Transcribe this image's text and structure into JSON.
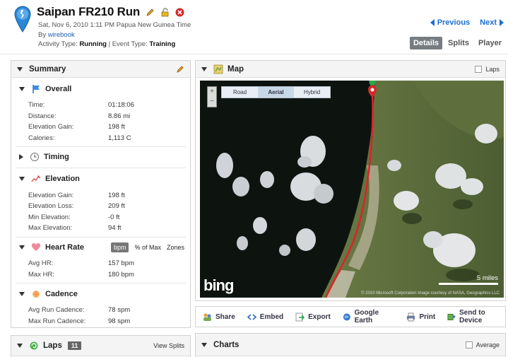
{
  "activity": {
    "title": "Saipan FR210 Run",
    "datetime": "Sat, Nov 6, 2010 1:11 PM Papua New Guinea Time",
    "by_prefix": "By ",
    "author": "wirebook",
    "activity_type_label": "Activity Type: ",
    "activity_type": "Running",
    "event_sep": " | Event Type: ",
    "event_type": "Training"
  },
  "nav": {
    "previous": "Previous",
    "next": "Next"
  },
  "tabs": [
    "Details",
    "Splits",
    "Player"
  ],
  "summary": {
    "title": "Summary",
    "overall": {
      "title": "Overall",
      "rows": [
        {
          "k": "Time:",
          "v": "01:18:06"
        },
        {
          "k": "Distance:",
          "v": "8.86 mi"
        },
        {
          "k": "Elevation Gain:",
          "v": "198 ft"
        },
        {
          "k": "Calories:",
          "v": "1,113 C"
        }
      ]
    },
    "timing": {
      "title": "Timing"
    },
    "elevation": {
      "title": "Elevation",
      "rows": [
        {
          "k": "Elevation Gain:",
          "v": "198 ft"
        },
        {
          "k": "Elevation Loss:",
          "v": "209 ft"
        },
        {
          "k": "Min Elevation:",
          "v": "-0 ft"
        },
        {
          "k": "Max Elevation:",
          "v": "94 ft"
        }
      ]
    },
    "heart_rate": {
      "title": "Heart Rate",
      "options": [
        "bpm",
        "% of Max",
        "Zones"
      ],
      "rows": [
        {
          "k": "Avg HR:",
          "v": "157 bpm"
        },
        {
          "k": "Max HR:",
          "v": "180 bpm"
        }
      ]
    },
    "cadence": {
      "title": "Cadence",
      "rows": [
        {
          "k": "Avg Run Cadence:",
          "v": "78 spm"
        },
        {
          "k": "Max Run Cadence:",
          "v": "98 spm"
        }
      ]
    }
  },
  "map": {
    "title": "Map",
    "laps_label": "Laps",
    "map_types": [
      "Road",
      "Aerial",
      "Hybrid"
    ],
    "selected_type": "Aerial",
    "logo": "bing",
    "scale": "5 miles",
    "credit": "© 2010 Microsoft Corporation   Image courtesy of NASA, Geographics LLC"
  },
  "actions": [
    "Share",
    "Embed",
    "Export",
    "Google Earth",
    "Print",
    "Send to Device"
  ],
  "laps": {
    "title": "Laps",
    "count": "11",
    "view_splits": "View Splits"
  },
  "charts": {
    "title": "Charts",
    "average_label": "Average"
  },
  "colors": {
    "accent": "#1a6fd0",
    "route": "#e0202a",
    "tab_active": "#777c80"
  }
}
